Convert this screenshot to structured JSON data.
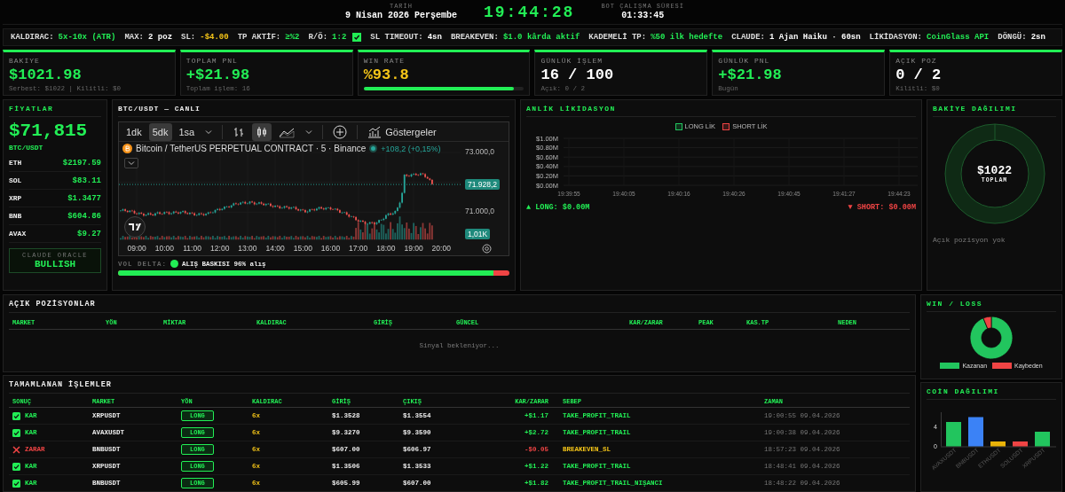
{
  "header": {
    "date_label": "TARİH",
    "date": "9 Nisan 2026 Perşembe",
    "clock": "19:44:28",
    "uptime_label": "BOT ÇALIŞMA SÜRESİ",
    "uptime": "01:33:45"
  },
  "config": [
    {
      "kind": "text",
      "label": "KALDIRAC:",
      "value": "5x-10x (ATR)",
      "color": "#22ee55"
    },
    {
      "kind": "text",
      "label": "MAX:",
      "value": "2 poz",
      "color": "#ffffff"
    },
    {
      "kind": "text",
      "label": "SL:",
      "value": "-$4.00",
      "color": "#f5c518"
    },
    {
      "kind": "text",
      "label": "TP AKTİF:",
      "value": "≥%2",
      "color": "#22ee55"
    },
    {
      "kind": "check",
      "label": "R/Ö:",
      "value": "1:2",
      "color": "#22ee55",
      "checked": true
    },
    {
      "kind": "text",
      "label": "SL TIMEOUT:",
      "value": "4sn",
      "color": "#ffffff"
    },
    {
      "kind": "text",
      "label": "BREAKEVEN:",
      "value": "$1.0 kârda aktif",
      "color": "#22ee55"
    },
    {
      "kind": "text",
      "label": "KADEMELİ TP:",
      "value": "%50 ilk hedefte",
      "color": "#22ee55"
    },
    {
      "kind": "text",
      "label": "CLAUDE:",
      "value": "1 Ajan Haiku · 60sn",
      "color": "#ffffff"
    },
    {
      "kind": "text",
      "label": "LİKİDASYON:",
      "value": "CoinGlass API",
      "color": "#22ee55"
    },
    {
      "kind": "text",
      "label": "DÖNGÜ:",
      "value": "2sn",
      "color": "#ffffff"
    }
  ],
  "stats": [
    {
      "label": "BAKİYE",
      "value": "$1021.98",
      "color": "#22ee55",
      "sub": "Serbest: $1022 | Kilitli: $0"
    },
    {
      "label": "TOPLAM PNL",
      "value": "+$21.98",
      "color": "#22ee55",
      "sub": "Toplam işlem: 16"
    },
    {
      "label": "WIN RATE",
      "value": "%93.8",
      "color": "#f5c518",
      "level": 0.938
    },
    {
      "label": "GÜNLÜK İŞLEM",
      "value": "16 / 100",
      "color": "#ffffff",
      "sub": "Açık: 0 / 2"
    },
    {
      "label": "GÜNLÜK PNL",
      "value": "+$21.98",
      "color": "#22ee55",
      "sub": "Bugün"
    },
    {
      "label": "AÇIK POZ",
      "value": "0 / 2",
      "color": "#ffffff",
      "sub": "Kilitli: $0"
    }
  ],
  "prices": {
    "title": "FİYATLAR",
    "main": "$71,815",
    "pair": "BTC/USDT",
    "coins": [
      {
        "symbol": "ETH",
        "price": "$2197.59"
      },
      {
        "symbol": "SOL",
        "price": "$83.11"
      },
      {
        "symbol": "XRP",
        "price": "$1.3477"
      },
      {
        "symbol": "BNB",
        "price": "$604.86"
      },
      {
        "symbol": "AVAX",
        "price": "$9.27"
      }
    ],
    "oracle_label": "CLAUDE ORACLE",
    "oracle": "BULLISH"
  },
  "chart": {
    "title": "BTC/USDT — CANLI",
    "intervals": [
      {
        "label": "1dk",
        "selected": false
      },
      {
        "label": "5dk",
        "selected": true
      },
      {
        "label": "1sa",
        "selected": false
      }
    ],
    "styles": [
      {
        "kind": "bars",
        "selected": false
      },
      {
        "kind": "candles",
        "selected": true
      },
      {
        "kind": "area",
        "selected": false
      }
    ],
    "indicators": "Göstergeler",
    "symbol": "Bitcoin / TetherUS PERPETUAL CONTRACT · 5 · Binance",
    "change": "+108,2 (+0,15%)",
    "price_labels": [
      "73.000,0",
      "71.000,0"
    ],
    "last_price": "71.928,2",
    "volume": "1,01K",
    "times": [
      "09:00",
      "10:00",
      "11:00",
      "12:00",
      "13:00",
      "14:00",
      "15:00",
      "16:00",
      "17:00",
      "18:00",
      "19:00",
      "20:00"
    ],
    "vol_delta_label": "VOL DELTA:",
    "vol_delta_text": "ALIŞ BASKISI 96% alış",
    "vol_delta": {
      "level": 0.96
    }
  },
  "liquidation": {
    "title": "ANLİK LİKİDASYON",
    "chart_data": {
      "type": "bar",
      "categories": [
        "19:39:55",
        "19:40:05",
        "19:40:16",
        "19:40:26",
        "19:40:45",
        "19:41:27",
        "19:44:23"
      ],
      "series": [
        {
          "name": "LONG LİK",
          "color": "#22c55e",
          "values": [
            0,
            0,
            0,
            0,
            0,
            0,
            0
          ]
        },
        {
          "name": "SHORT LİK",
          "color": "#ef4444",
          "values": [
            0,
            0,
            0,
            0,
            0,
            0,
            0
          ]
        }
      ],
      "ylim": [
        0,
        1
      ],
      "grid": true,
      "legend": true,
      "yticks": [
        {
          "value": 0,
          "label": "$0.00M"
        },
        {
          "value": 0.2,
          "label": "$0.20M"
        },
        {
          "value": 0.4,
          "label": "$0.40M"
        },
        {
          "value": 0.6,
          "label": "$0.60M"
        },
        {
          "value": 0.8,
          "label": "$0.80M"
        },
        {
          "value": 1,
          "label": "$1.00M"
        }
      ]
    },
    "long": "▲ LONG: $0.00M",
    "short": "▼ SHORT: $0.00M"
  },
  "balance": {
    "title": "BAKİYE DAĞILIMI",
    "total": "$1022",
    "total_label": "TOPLAM",
    "empty": "Açık pozisyon yok"
  },
  "positions": {
    "title": "AÇIK POZİSYONLAR",
    "columns": [
      "MARKET",
      "YÖN",
      "MİKTAR",
      "KALDIRAC",
      "GİRİŞ",
      "GÜNCEL",
      "KAR/ZARAR",
      "PEAK",
      "KAS.TP",
      "NEDEN"
    ],
    "empty": "Sinyal bekleniyor..."
  },
  "trades": {
    "title": "TAMAMLANAN İŞLEMLER",
    "columns": [
      "SONUÇ",
      "MARKET",
      "YÖN",
      "KALDIRAC",
      "GİRİŞ",
      "ÇIKIŞ",
      "KAR/ZARAR",
      "SEBEP",
      "ZAMAN"
    ],
    "rows": [
      {
        "kind": "win",
        "result": "KAR",
        "market": "XRPUSDT",
        "side": "LONG",
        "leverage": "6x",
        "entry": "$1.3528",
        "exit": "$1.3554",
        "pnl": "+$1.17",
        "reason": "TAKE_PROFIT_TRAIL",
        "time": "19:00:55 09.04.2026"
      },
      {
        "kind": "win",
        "result": "KAR",
        "market": "AVAXUSDT",
        "side": "LONG",
        "leverage": "6x",
        "entry": "$9.3270",
        "exit": "$9.3590",
        "pnl": "+$2.72",
        "reason": "TAKE_PROFIT_TRAIL",
        "time": "19:00:38 09.04.2026"
      },
      {
        "kind": "loss",
        "result": "ZARAR",
        "market": "BNBUSDT",
        "side": "LONG",
        "leverage": "6x",
        "entry": "$607.00",
        "exit": "$606.97",
        "pnl": "-$0.05",
        "reason": "BREAKEVEN_SL",
        "time": "18:57:23 09.04.2026"
      },
      {
        "kind": "win",
        "result": "KAR",
        "market": "XRPUSDT",
        "side": "LONG",
        "leverage": "6x",
        "entry": "$1.3506",
        "exit": "$1.3533",
        "pnl": "+$1.22",
        "reason": "TAKE_PROFIT_TRAIL",
        "time": "18:48:41 09.04.2026"
      },
      {
        "kind": "win",
        "result": "KAR",
        "market": "BNBUSDT",
        "side": "LONG",
        "leverage": "6x",
        "entry": "$605.99",
        "exit": "$607.00",
        "pnl": "+$1.82",
        "reason": "TAKE_PROFIT_TRAIL_NIŞANCI",
        "time": "18:48:22 09.04.2026"
      }
    ]
  },
  "winloss": {
    "title": "WIN / LOSS",
    "chart_data": {
      "type": "donut",
      "categories": [
        "Kazanan",
        "Kaybeden"
      ],
      "series": [
        {
          "values": [
            93.8,
            6.2
          ]
        }
      ],
      "legend": true
    },
    "slices": [
      {
        "color": "#22c55e"
      },
      {
        "color": "#ef4444"
      }
    ]
  },
  "coins": {
    "title": "COİN DAĞILIMI",
    "chart_data": {
      "type": "bar",
      "categories": [
        "AVAXUSDT",
        "BNBUSDT",
        "ETHUSDT",
        "SOLUSDT",
        "XRPUSDT"
      ],
      "series": [
        {
          "values": [
            5,
            6,
            1,
            1,
            3
          ]
        }
      ],
      "ylim": [
        0,
        7
      ],
      "yticks": [
        0,
        4
      ]
    },
    "bars": [
      {
        "color": "#22c55e"
      },
      {
        "color": "#3b82f6"
      },
      {
        "color": "#eab308"
      },
      {
        "color": "#ef4444"
      },
      {
        "color": "#22c55e"
      }
    ]
  }
}
